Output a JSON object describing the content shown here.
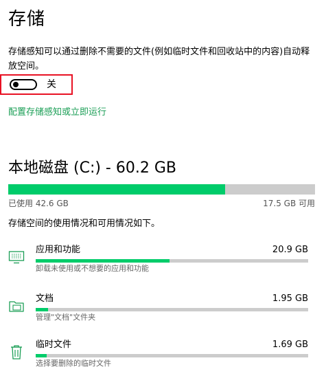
{
  "header": {
    "title": "存储"
  },
  "storage_sense": {
    "description": "存储感知可以通过删除不需要的文件(例如临时文件和回收站中的内容)自动释放空间。",
    "toggle_state": "关",
    "toggle_on": false,
    "config_link": "配置存储感知或立即运行"
  },
  "disk": {
    "title": "本地磁盘 (C:) - 60.2 GB",
    "used_label": "已使用 42.6 GB",
    "free_label": "17.5 GB 可用",
    "used_fraction": 0.708,
    "bar_color": "#00cc6a",
    "intro": "存储空间的使用情况和可用情况如下。"
  },
  "categories": [
    {
      "icon": "monitor-icon",
      "name": "应用和功能",
      "size": "20.9 GB",
      "fraction": 0.49,
      "description": "卸载未使用或不想要的应用和功能"
    },
    {
      "icon": "folder-icon",
      "name": "文档",
      "size": "1.95 GB",
      "fraction": 0.045,
      "description": "管理\"文档\"文件夹"
    },
    {
      "icon": "trash-icon",
      "name": "临时文件",
      "size": "1.69 GB",
      "fraction": 0.04,
      "description": "选择要删除的临时文件"
    }
  ],
  "colors": {
    "accent": "#1a9e55",
    "highlight_border": "#e81123"
  }
}
